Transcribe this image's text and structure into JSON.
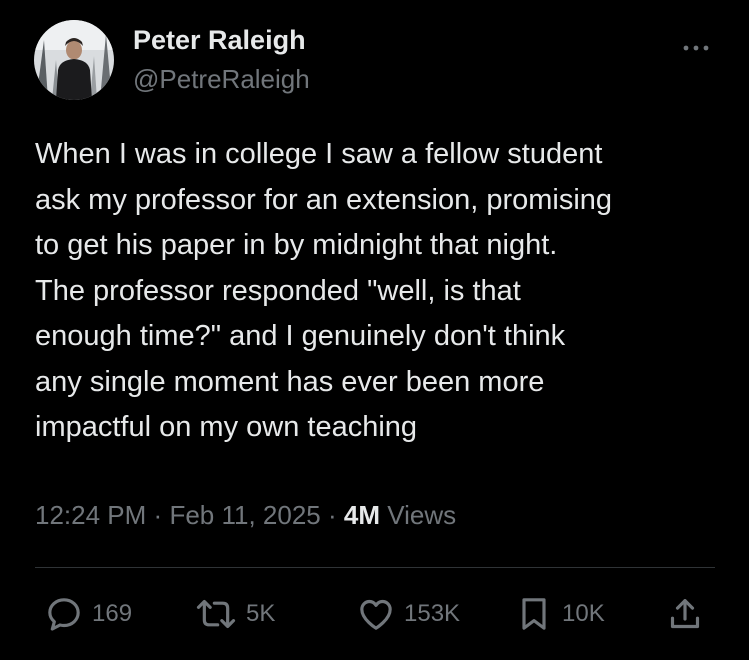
{
  "author": {
    "display_name": "Peter Raleigh",
    "handle": "@PetreRaleigh"
  },
  "tweet": {
    "text_lines": [
      "When I was in college I saw a fellow student",
      "ask my professor for an extension, promising",
      "to get his paper in by midnight that night.",
      "The professor responded \"well, is that",
      "enough time?\" and I genuinely don't think",
      "any single moment has ever been more",
      "impactful on my own teaching"
    ],
    "time": "12:24 PM",
    "separator": "·",
    "date": "Feb 11, 2025",
    "views_count": "4M",
    "views_label": "Views"
  },
  "actions": {
    "replies": "169",
    "reposts": "5K",
    "likes": "153K",
    "bookmarks": "10K"
  },
  "icons": {
    "more": "more-horizontal-icon",
    "reply": "reply-icon",
    "repost": "repost-icon",
    "like": "heart-icon",
    "bookmark": "bookmark-icon",
    "share": "share-icon"
  },
  "colors": {
    "background": "#000000",
    "primary_text": "#e7e9ea",
    "secondary_text": "#71767b",
    "divider": "#2f3336"
  }
}
